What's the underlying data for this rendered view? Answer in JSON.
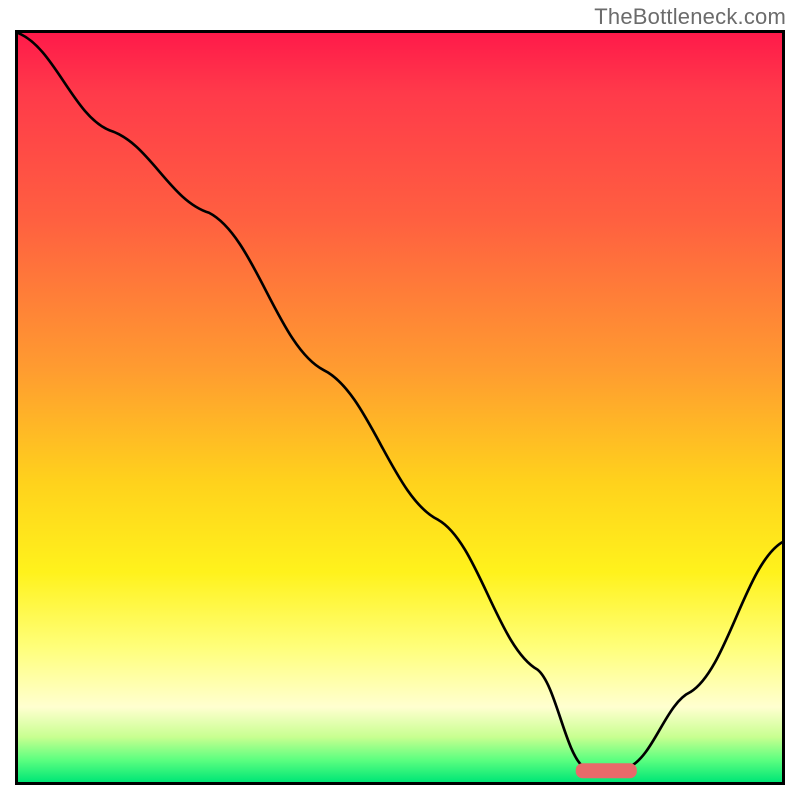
{
  "watermark": "TheBottleneck.com",
  "chart_data": {
    "type": "line",
    "title": "",
    "xlabel": "",
    "ylabel": "",
    "xlim": [
      0,
      100
    ],
    "ylim": [
      0,
      100
    ],
    "grid": false,
    "legend": false,
    "series": [
      {
        "name": "bottleneck-curve",
        "x": [
          0,
          12,
          25,
          40,
          55,
          68,
          74,
          80,
          88,
          100
        ],
        "y": [
          100,
          87,
          76,
          55,
          35,
          15,
          2,
          2,
          12,
          32
        ]
      }
    ],
    "marker": {
      "name": "optimal-zone-marker",
      "x_center": 77,
      "y": 1.5,
      "width": 8,
      "color": "#e86a6a"
    },
    "background_gradient_stops": [
      {
        "pos": 0,
        "color": "#ff1a4a"
      },
      {
        "pos": 8,
        "color": "#ff3a4a"
      },
      {
        "pos": 25,
        "color": "#ff6040"
      },
      {
        "pos": 45,
        "color": "#ff9c30"
      },
      {
        "pos": 60,
        "color": "#ffd21c"
      },
      {
        "pos": 72,
        "color": "#fff21c"
      },
      {
        "pos": 82,
        "color": "#ffff7a"
      },
      {
        "pos": 90,
        "color": "#ffffd0"
      },
      {
        "pos": 94,
        "color": "#c8ff90"
      },
      {
        "pos": 97,
        "color": "#5eff80"
      },
      {
        "pos": 100,
        "color": "#00e676"
      }
    ]
  }
}
